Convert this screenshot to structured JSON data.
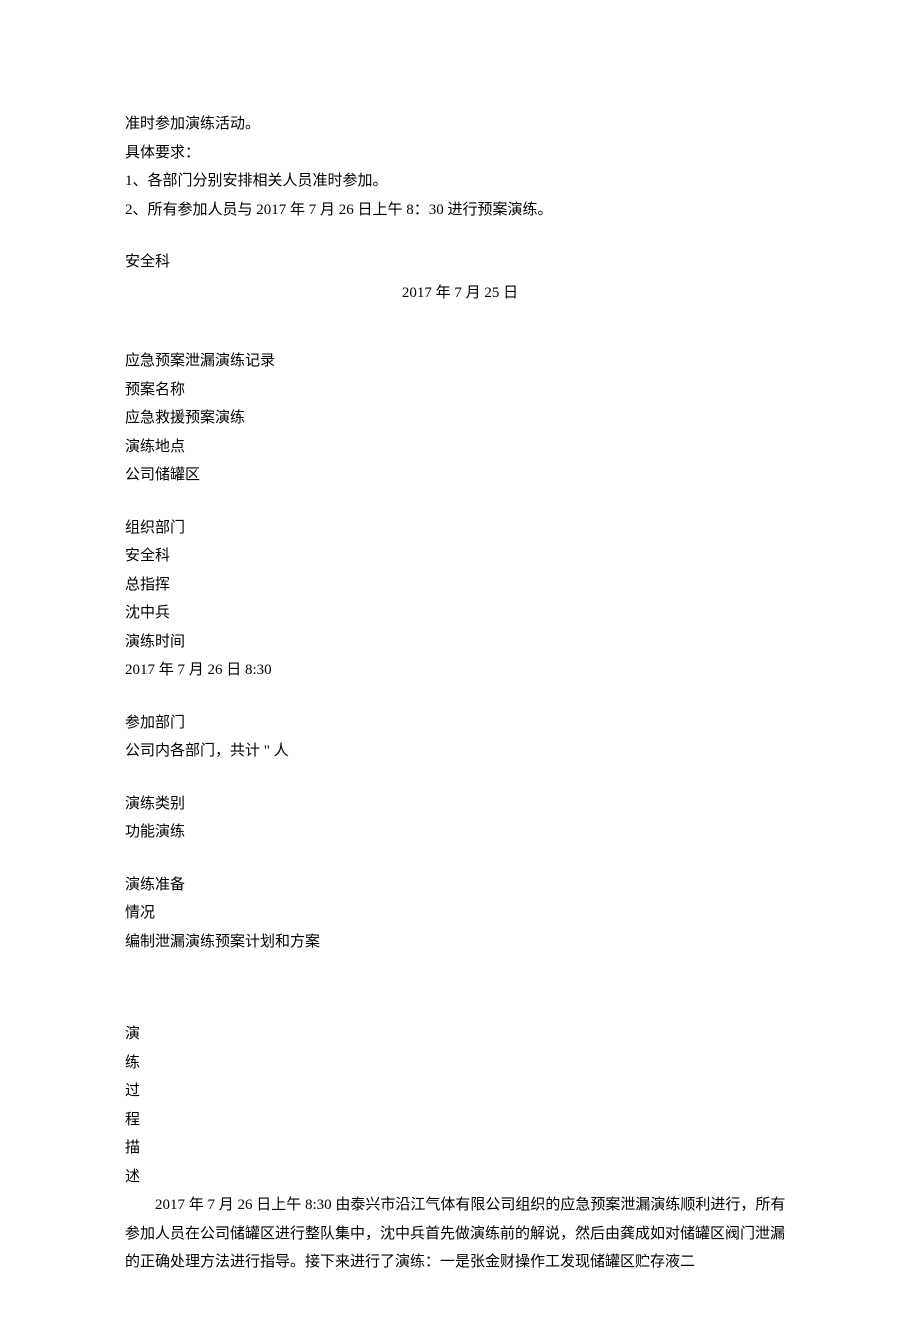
{
  "notice": {
    "line1": "准时参加演练活动。",
    "line2": "具体要求：",
    "line3": "1、各部门分别安排相关人员准时参加。",
    "line4": "2、所有参加人员与 2017 年 7 月 26 日上午 8：30 进行预案演练。",
    "dept": "安全科",
    "date": "2017 年 7 月 25 日"
  },
  "record": {
    "title": "应急预案泄漏演练记录",
    "plan_name_label": "预案名称",
    "plan_name": "应急救援预案演练",
    "location_label": "演练地点",
    "location": "公司储罐区",
    "org_dept_label": "组织部门",
    "org_dept": "安全科",
    "commander_label": "总指挥",
    "commander": "沈中兵",
    "time_label": "演练时间",
    "time": "2017 年 7 月 26 日 8:30",
    "participants_label": "参加部门",
    "participants": "公司内各部门，共计 \" 人",
    "category_label": "演练类别",
    "category": "功能演练",
    "prep_label_a": "演练准备",
    "prep_label_b": "情况",
    "prep": "编制泄漏演练预案计划和方案",
    "process_label_a": "演",
    "process_label_b": "练",
    "process_label_c": "过",
    "process_label_d": "程",
    "process_label_e": "描",
    "process_label_f": "述",
    "process_text": "2017 年 7 月 26 日上午 8:30 由泰兴市沿江气体有限公司组织的应急预案泄漏演练顺利进行，所有参加人员在公司储罐区进行整队集中，沈中兵首先做演练前的解说，然后由龚成如对储罐区阀门泄漏的正确处理方法进行指导。接下来进行了演练：一是张金财操作工发现储罐区贮存液二"
  }
}
